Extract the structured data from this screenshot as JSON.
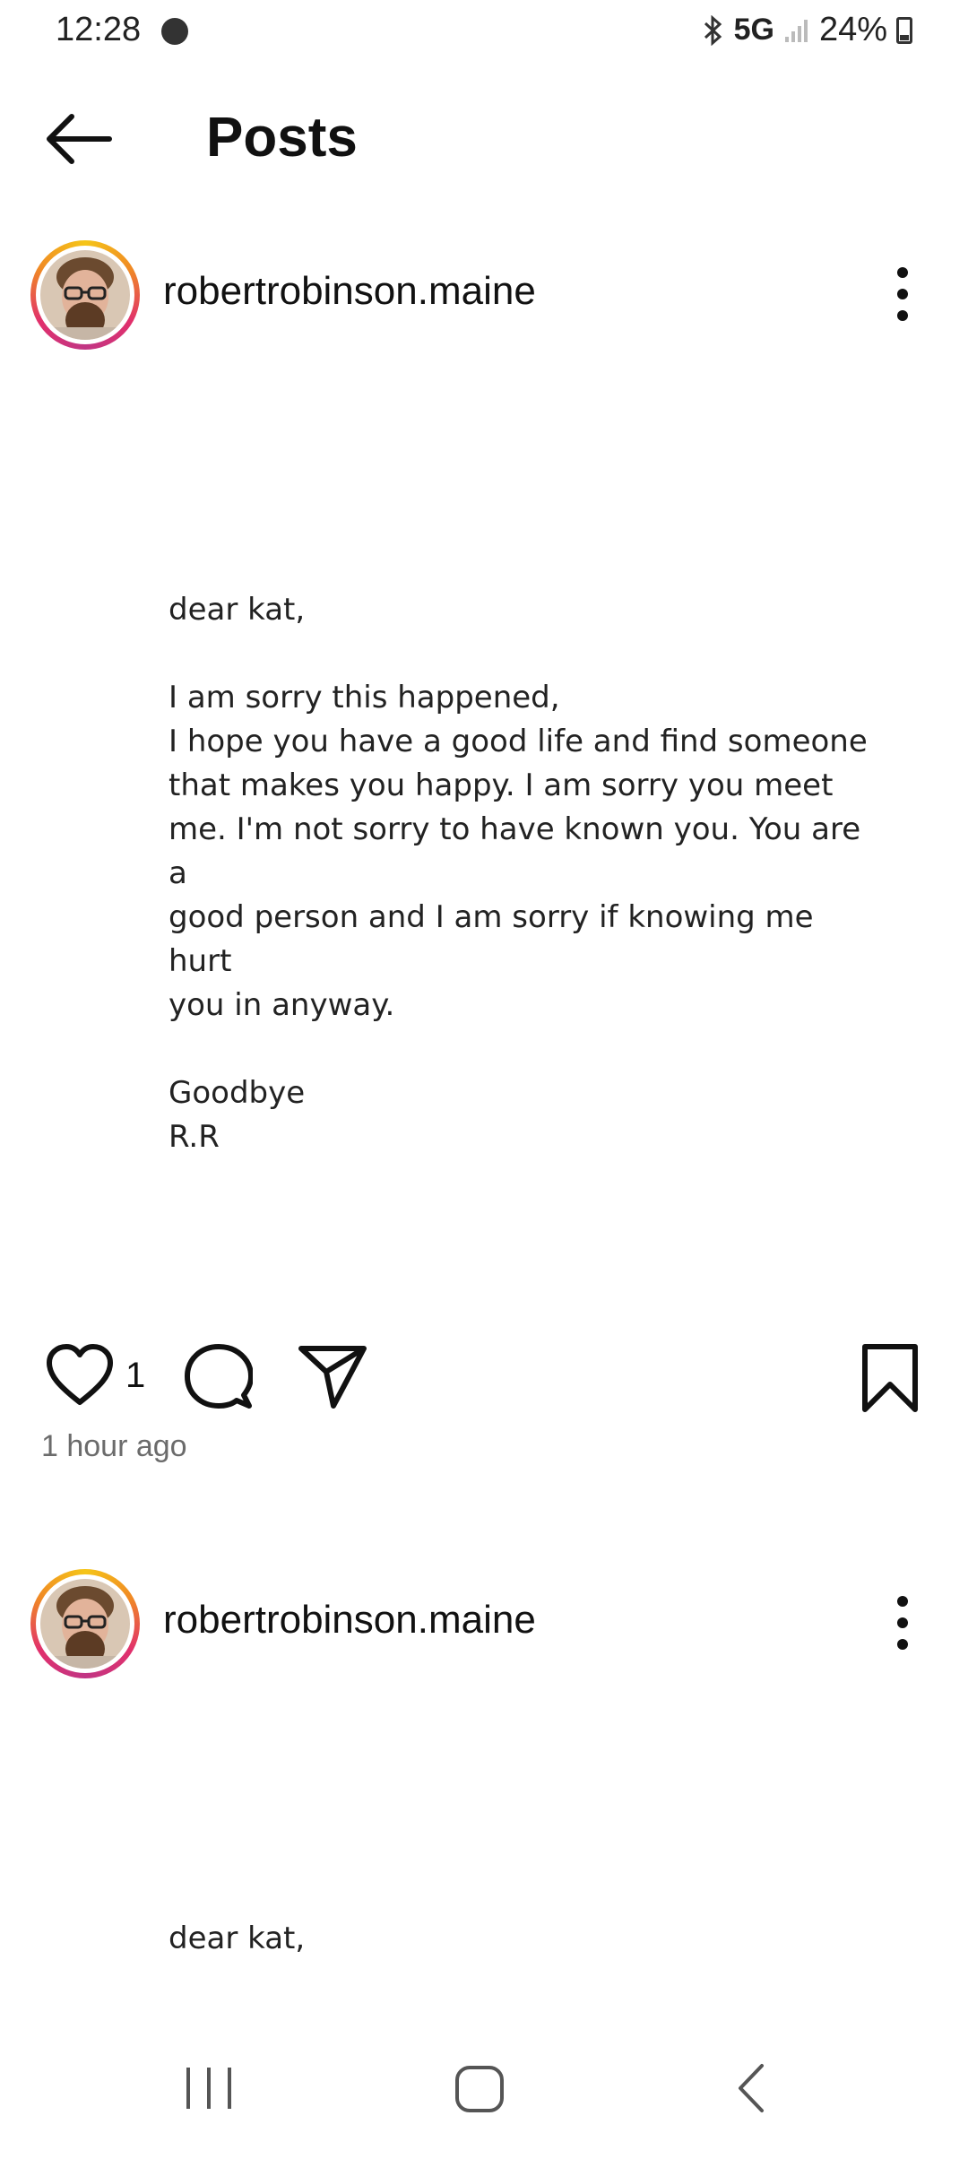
{
  "status_bar": {
    "time": "12:28",
    "network": "5G",
    "battery": "24%",
    "icons": [
      "notification-dot-icon",
      "bluetooth-icon",
      "signal-icon",
      "battery-icon"
    ]
  },
  "header": {
    "title": "Posts",
    "back_icon": "arrow-left-icon"
  },
  "posts": [
    {
      "username": "robertrobinson.maine",
      "menu_icon": "more-vertical-icon",
      "letter": {
        "greeting": "dear kat,",
        "line1": "I am sorry this happened,",
        "body": "I hope you have a good life and find someone\nthat makes you happy. I am sorry you meet\nme. I'm not sorry to have known you. You are a\ngood person and I am sorry if knowing me hurt\nyou in anyway.",
        "closing": "Goodbye",
        "signature": "R.R"
      },
      "like_count": "1",
      "timestamp": "1 hour ago"
    },
    {
      "username": "robertrobinson.maine",
      "menu_icon": "more-vertical-icon",
      "letter": {
        "greeting": "dear kat,"
      }
    }
  ],
  "colors": {
    "text": "#111111",
    "muted": "#6b6b6b",
    "story_ring": [
      "#f5c518",
      "#e1306c",
      "#c13584"
    ]
  },
  "nav_bar": {
    "icons": [
      "recents-icon",
      "home-icon",
      "back-icon"
    ]
  }
}
